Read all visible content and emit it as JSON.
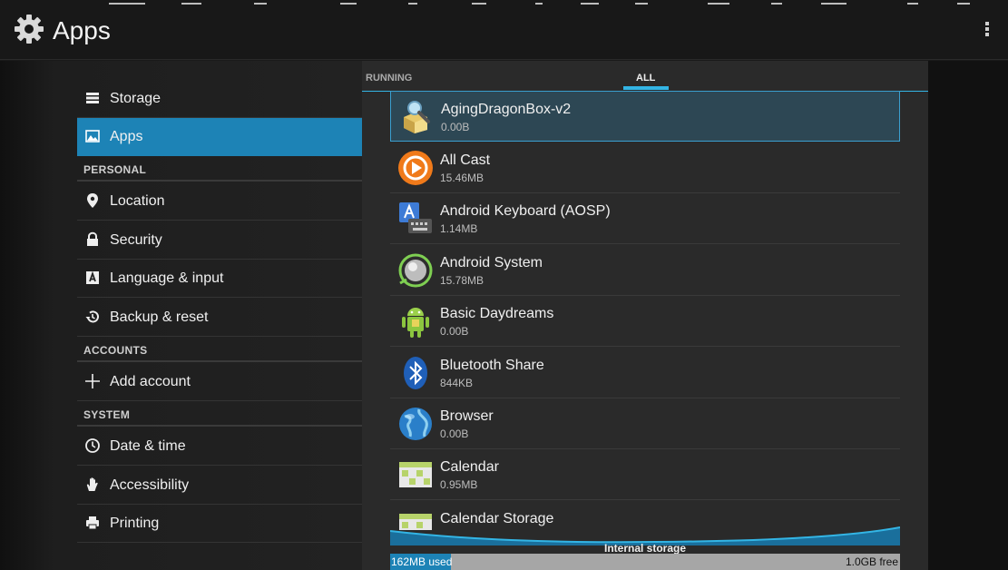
{
  "header": {
    "title": "Apps"
  },
  "nav": {
    "storage": "Storage",
    "apps": "Apps",
    "personal_header": "PERSONAL",
    "location": "Location",
    "security": "Security",
    "language": "Language & input",
    "backup": "Backup & reset",
    "accounts_header": "ACCOUNTS",
    "add_account": "Add account",
    "system_header": "SYSTEM",
    "date_time": "Date & time",
    "accessibility": "Accessibility",
    "printing": "Printing"
  },
  "tabs": {
    "running": "RUNNING",
    "all": "ALL"
  },
  "apps": [
    {
      "name": "AgingDragonBox-v2",
      "size": "0.00B",
      "icon": "magnifier-box-icon"
    },
    {
      "name": "All Cast",
      "size": "15.46MB",
      "icon": "allcast-icon"
    },
    {
      "name": "Android Keyboard (AOSP)",
      "size": "1.14MB",
      "icon": "keyboard-icon"
    },
    {
      "name": "Android System",
      "size": "15.78MB",
      "icon": "android-system-icon"
    },
    {
      "name": "Basic Daydreams",
      "size": "0.00B",
      "icon": "android-robot-icon"
    },
    {
      "name": "Bluetooth Share",
      "size": "844KB",
      "icon": "bluetooth-icon"
    },
    {
      "name": "Browser",
      "size": "0.00B",
      "icon": "globe-icon"
    },
    {
      "name": "Calendar",
      "size": "0.95MB",
      "icon": "calendar-icon"
    },
    {
      "name": "Calendar Storage",
      "size": "",
      "icon": "calendar-icon"
    }
  ],
  "storage": {
    "label": "Internal storage",
    "used": "162MB used",
    "free": "1.0GB free",
    "used_fraction": 0.12
  },
  "colors": {
    "accent": "#33b5e5",
    "selected": "#1d83b6"
  }
}
